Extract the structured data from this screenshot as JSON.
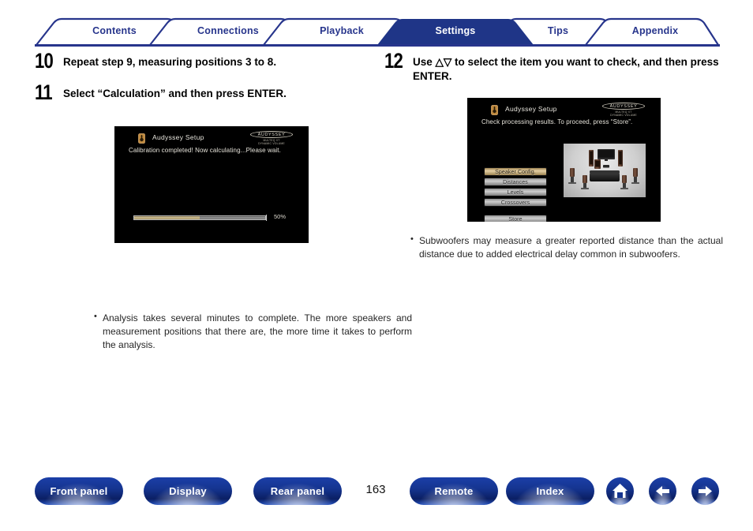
{
  "nav_tabs": [
    {
      "label": "Contents",
      "active": false
    },
    {
      "label": "Connections",
      "active": false
    },
    {
      "label": "Playback",
      "active": false
    },
    {
      "label": "Settings",
      "active": true
    },
    {
      "label": "Tips",
      "active": false
    },
    {
      "label": "Appendix",
      "active": false
    }
  ],
  "colors": {
    "brand_blue": "#27358c",
    "active_tab_fill": "#1f3587",
    "footer_blue": "#15348f",
    "osd_background": "#000000",
    "osd_highlight": "#d8c79a",
    "progress_fill": "#d8c79a"
  },
  "left_column": {
    "step_10": {
      "number": "10",
      "text": "Repeat step 9, measuring positions 3 to 8."
    },
    "step_11": {
      "number": "11",
      "text": "Select “Calculation” and then press ENTER."
    },
    "osd": {
      "icon_name": "audyssey-mic-icon",
      "title": "Audyssey Setup",
      "message": "Calibration completed! Now calculating...Please wait.",
      "logo": {
        "brand": "AUDYSSEY",
        "line1": "MULTEQ XT",
        "line2": "DYNAMIC VOLUME"
      },
      "progress_percent_label": "50%",
      "progress_value": 50
    },
    "note": "Analysis takes several minutes to complete. The more speakers and measurement positions that there are, the more time it takes to perform the analysis."
  },
  "right_column": {
    "step_12": {
      "number": "12",
      "text": "Use △▽ to select the item you want to check, and then press ENTER."
    },
    "osd": {
      "icon_name": "audyssey-mic-icon",
      "title": "Audyssey Setup",
      "message": "Check processing results. To proceed, press “Store”.",
      "logo": {
        "brand": "AUDYSSEY",
        "line1": "MULTEQ XT",
        "line2": "DYNAMIC VOLUME"
      },
      "menu_items": [
        {
          "label": "Speaker Config.",
          "selected": true
        },
        {
          "label": "Distances",
          "selected": false
        },
        {
          "label": "Levels",
          "selected": false
        },
        {
          "label": "Crossovers",
          "selected": false
        }
      ],
      "store_button": {
        "label": "Store",
        "selected": false
      },
      "diagram_name": "speaker-layout-diagram"
    },
    "note": "Subwoofers may measure a greater reported distance than the actual distance due to added electrical delay common in subwoofers."
  },
  "footer": {
    "buttons": [
      {
        "label": "Front panel"
      },
      {
        "label": "Display"
      },
      {
        "label": "Rear panel"
      },
      {
        "label": "Remote"
      },
      {
        "label": "Index"
      }
    ],
    "page_number": "163",
    "icon_buttons": [
      {
        "name": "home-icon"
      },
      {
        "name": "arrow-left-icon"
      },
      {
        "name": "arrow-right-icon"
      }
    ]
  }
}
